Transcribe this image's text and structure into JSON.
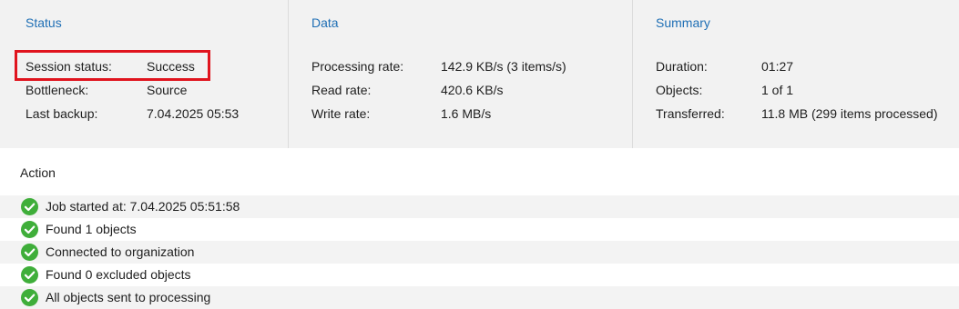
{
  "status": {
    "title": "Status",
    "rows": [
      {
        "label": "Session status:",
        "value": "Success"
      },
      {
        "label": "Bottleneck:",
        "value": "Source"
      },
      {
        "label": "Last backup:",
        "value": "7.04.2025 05:53"
      }
    ]
  },
  "data": {
    "title": "Data",
    "rows": [
      {
        "label": "Processing rate:",
        "value": "142.9 KB/s (3 items/s)"
      },
      {
        "label": "Read rate:",
        "value": "420.6 KB/s"
      },
      {
        "label": "Write rate:",
        "value": "1.6 MB/s"
      }
    ]
  },
  "summary": {
    "title": "Summary",
    "rows": [
      {
        "label": "Duration:",
        "value": "01:27"
      },
      {
        "label": "Objects:",
        "value": "1 of 1"
      },
      {
        "label": "Transferred:",
        "value": "11.8 MB (299 items processed)"
      }
    ]
  },
  "action": {
    "title": "Action",
    "items": [
      {
        "icon": "success-check-icon",
        "text": "Job started at: 7.04.2025 05:51:58"
      },
      {
        "icon": "success-check-icon",
        "text": "Found 1 objects"
      },
      {
        "icon": "success-check-icon",
        "text": "Connected to organization"
      },
      {
        "icon": "success-check-icon",
        "text": "Found 0 excluded objects"
      },
      {
        "icon": "success-check-icon",
        "text": "All objects sent to processing"
      }
    ]
  },
  "colors": {
    "header_blue": "#1f6fb5",
    "highlight_red": "#e0141e",
    "success_green": "#3fae3a",
    "panel_bg": "#f2f2f2"
  }
}
